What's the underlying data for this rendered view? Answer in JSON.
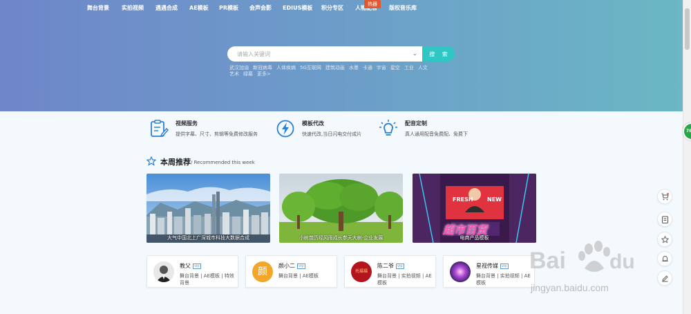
{
  "nav": {
    "items": [
      "舞台背景",
      "实拍视频",
      "遇遇合成",
      "AE模板",
      "PR模板",
      "会声会影",
      "EDIUS模板",
      "积分专区",
      "人物配音",
      "版权音乐库"
    ],
    "hot_badge": "热器"
  },
  "search": {
    "placeholder": "请输入关键词",
    "button_label": "搜 索",
    "hot_tags": [
      "武汉加油",
      "新冠病毒",
      "人体疾病",
      "5G互联网",
      "建筑动画",
      "水墨",
      "卡通",
      "宇宙",
      "星空",
      "工业",
      "人文",
      "艺术",
      "绿幕",
      "更多>"
    ]
  },
  "services": [
    {
      "title": "视频服务",
      "desc": "提供字幕、尺寸、剪辑等免费修改服务",
      "icon": "clipboard-pen-icon"
    },
    {
      "title": "模板代改",
      "desc": "快速代改,当日闪电交付成片",
      "icon": "lightning-icon"
    },
    {
      "title": "配音定制",
      "desc": "真人通用配音免费配、免费下",
      "icon": "lightbulb-icon"
    }
  ],
  "weekly": {
    "title": "本周推荐",
    "subtitle": "/ Recommended this week",
    "cards": [
      {
        "caption": "大气中国北上广深城市科技大数据合成"
      },
      {
        "caption": "小树苗历经风雨成长参天大树-企业发展"
      },
      {
        "caption": "电商产品模板",
        "overlay_top": "FRESH",
        "overlay_right": "NEW",
        "overlay_big": "超市百货"
      }
    ]
  },
  "authors": [
    {
      "name": "教父",
      "vip": "vip",
      "tags": "舞台背景 | AE模板 | 特效背景"
    },
    {
      "name": "颜小二",
      "vip": "vip",
      "tags": "舞台背景 | AE模板",
      "avatar_char": "颜"
    },
    {
      "name": "陈二爷",
      "vip": "vip",
      "tags": "舞台背景 | 实拍视频 | AE模板",
      "avatar_text": "托福福"
    },
    {
      "name": "星视传媒",
      "vip": "vip",
      "tags": "舞台背景 | 实拍视频 | AE模板"
    }
  ],
  "sidebar": {
    "icons": [
      "cart-icon",
      "clipboard-icon",
      "star-icon",
      "bell-icon",
      "edit-icon"
    ],
    "float_badge": "76"
  },
  "watermark": {
    "url": "jingyan.baidu.com"
  },
  "colors": {
    "accent": "#2ec7c4",
    "hot": "#e6572d",
    "hero_left": "#6f86c9",
    "hero_right": "#6bb7c4"
  }
}
